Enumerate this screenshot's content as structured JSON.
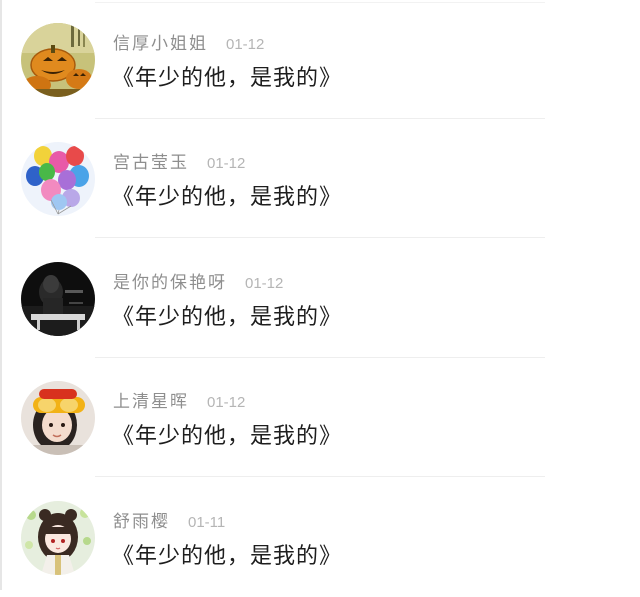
{
  "comments": [
    {
      "user": "信厚小姐姐",
      "date": "01-12",
      "message": "《年少的他，是我的》",
      "avatar_icon": "pumpkin-avatar"
    },
    {
      "user": "宫古莹玉",
      "date": "01-12",
      "message": "《年少的他，是我的》",
      "avatar_icon": "balloons-avatar"
    },
    {
      "user": "是你的保艳呀",
      "date": "01-12",
      "message": "《年少的他，是我的》",
      "avatar_icon": "dark-photo-avatar"
    },
    {
      "user": "上清星晖",
      "date": "01-12",
      "message": "《年少的他，是我的》",
      "avatar_icon": "girl-goggles-avatar"
    },
    {
      "user": "舒雨樱",
      "date": "01-11",
      "message": "《年少的他，是我的》",
      "avatar_icon": "anime-girl-avatar"
    }
  ],
  "colors": {
    "user_name": "#8e8e8e",
    "date": "#b5b5b5",
    "message": "#1e1e1e",
    "divider": "#eeeeee"
  }
}
